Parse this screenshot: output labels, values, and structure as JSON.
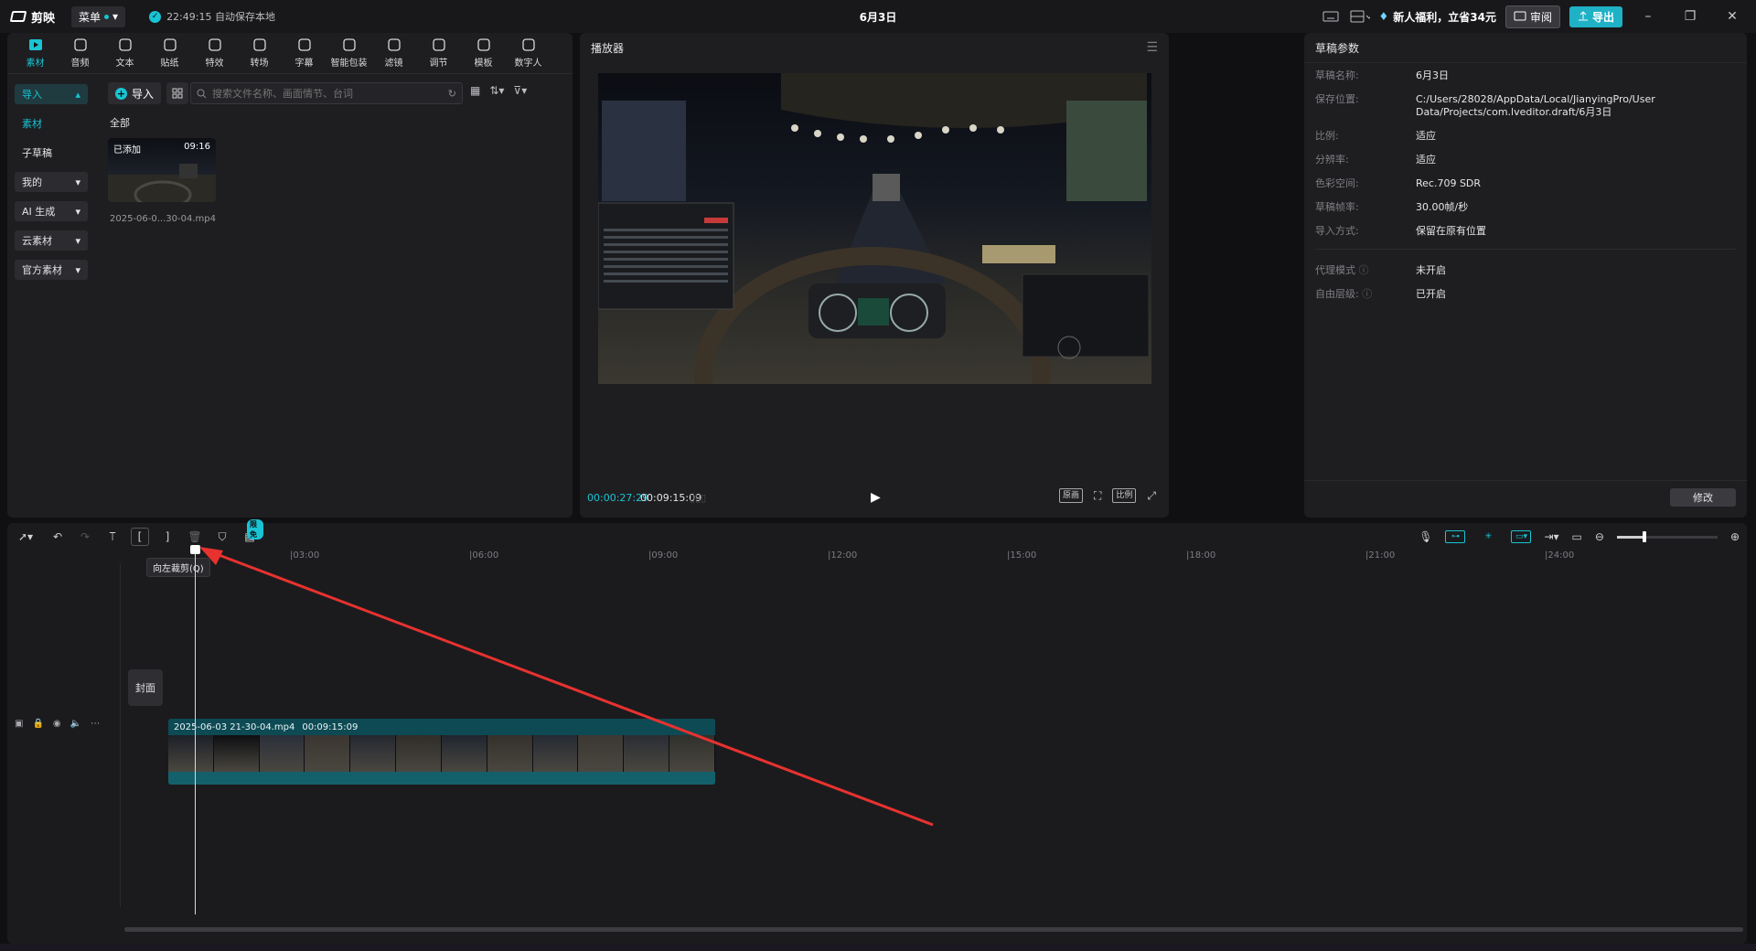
{
  "app": {
    "name": "剪映",
    "menu_label": "菜单",
    "autosave": "22:49:15 自动保存本地",
    "project_title": "6月3日"
  },
  "titlebar": {
    "promo": "新人福利，立省34元",
    "review_label": "审阅",
    "export_label": "导出"
  },
  "categories": [
    {
      "label": "素材",
      "icon": "media-icon"
    },
    {
      "label": "音频",
      "icon": "audio-icon"
    },
    {
      "label": "文本",
      "icon": "text-icon"
    },
    {
      "label": "贴纸",
      "icon": "sticker-icon"
    },
    {
      "label": "特效",
      "icon": "effects-icon"
    },
    {
      "label": "转场",
      "icon": "transition-icon"
    },
    {
      "label": "字幕",
      "icon": "subtitle-icon"
    },
    {
      "label": "智能包装",
      "icon": "smart-pack-icon"
    },
    {
      "label": "滤镜",
      "icon": "filter-icon"
    },
    {
      "label": "调节",
      "icon": "adjust-icon"
    },
    {
      "label": "模板",
      "icon": "template-icon"
    },
    {
      "label": "数字人",
      "icon": "avatar-icon"
    }
  ],
  "side_nav": {
    "import": "导入",
    "material": "素材",
    "sub_draft": "子草稿",
    "mine": "我的",
    "ai": "AI 生成",
    "cloud": "云素材",
    "official": "官方素材"
  },
  "media": {
    "import_label": "导入",
    "search_placeholder": "搜索文件名称、画面情节、台词",
    "section_label": "全部",
    "item_added": "已添加",
    "item_duration": "09:16",
    "item_name": "2025-06-0...30-04.mp4"
  },
  "player": {
    "title": "播放器",
    "current_time": "00:00:27:29",
    "total_time": "00:09:15:09",
    "btn_original": "原画",
    "btn_ratio": "比例"
  },
  "props": {
    "title": "草稿参数",
    "rows": [
      {
        "k": "草稿名称:",
        "v": "6月3日"
      },
      {
        "k": "保存位置:",
        "v": "C:/Users/28028/AppData/Local/JianyingPro/User Data/Projects/com.lveditor.draft/6月3日"
      },
      {
        "k": "比例:",
        "v": "适应"
      },
      {
        "k": "分辨率:",
        "v": "适应"
      },
      {
        "k": "色彩空间:",
        "v": "Rec.709 SDR"
      },
      {
        "k": "草稿帧率:",
        "v": "30.00帧/秒"
      },
      {
        "k": "导入方式:",
        "v": "保留在原有位置"
      }
    ],
    "rows2": [
      {
        "k": "代理模式",
        "v": "未开启"
      },
      {
        "k": "自由层级:",
        "v": "已开启"
      }
    ],
    "modify_label": "修改"
  },
  "timeline": {
    "badge": "限免",
    "tooltip": "向左裁剪(Q)",
    "ruler": [
      "|03:00",
      "|06:00",
      "|09:00",
      "|12:00",
      "|15:00",
      "|18:00",
      "|21:00",
      "|24:00"
    ],
    "cover_label": "封面",
    "clip_name": "2025-06-03 21-30-04.mp4",
    "clip_duration": "00:09:15:09"
  },
  "colors": {
    "accent": "#19c4d4",
    "arrow": "#e8322f"
  }
}
